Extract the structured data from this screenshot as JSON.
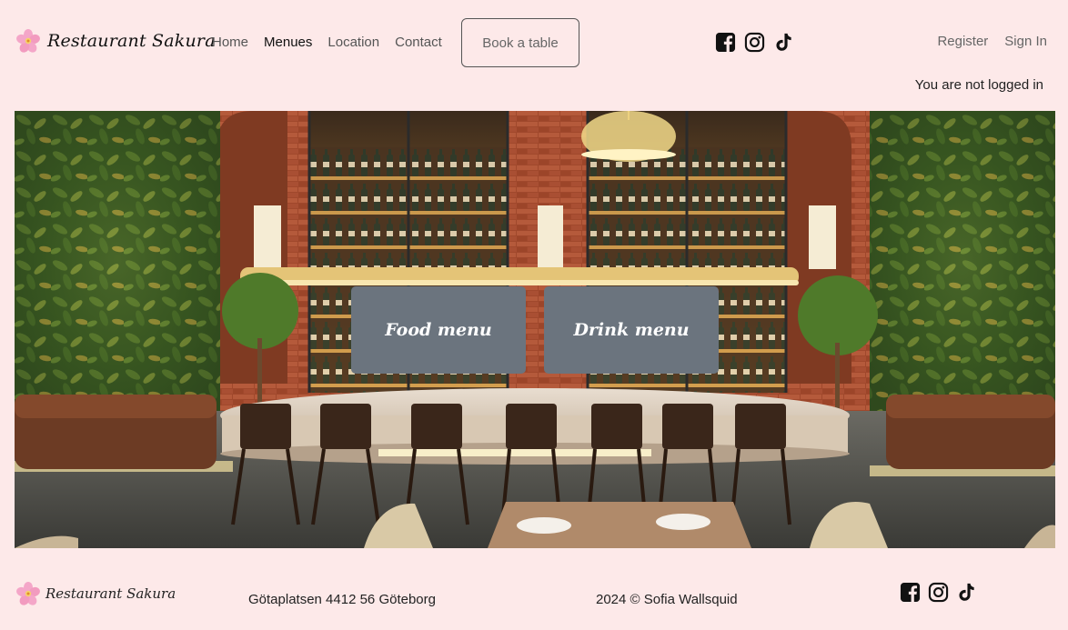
{
  "navbar": {
    "brand": "Restaurant Sakura",
    "links": [
      "Home",
      "Menues",
      "Location",
      "Contact"
    ],
    "active_link": "Menues",
    "book_label": "Book a table",
    "socials": [
      "facebook-icon",
      "instagram-icon",
      "tiktok-icon"
    ],
    "register": "Register",
    "sign_in": "Sign In",
    "login_status": "You are not logged in"
  },
  "hero": {
    "food_menu": "Food menu",
    "drink_menu": "Drink menu"
  },
  "footer": {
    "brand": "Restaurant Sakura",
    "address": "Götaplatsen 4412 56 Göteborg",
    "copyright": "2024 © Sofia Wallsquid"
  },
  "colors": {
    "background": "#fde9e9",
    "menu_button": "#6b747e",
    "text": "#222222"
  }
}
